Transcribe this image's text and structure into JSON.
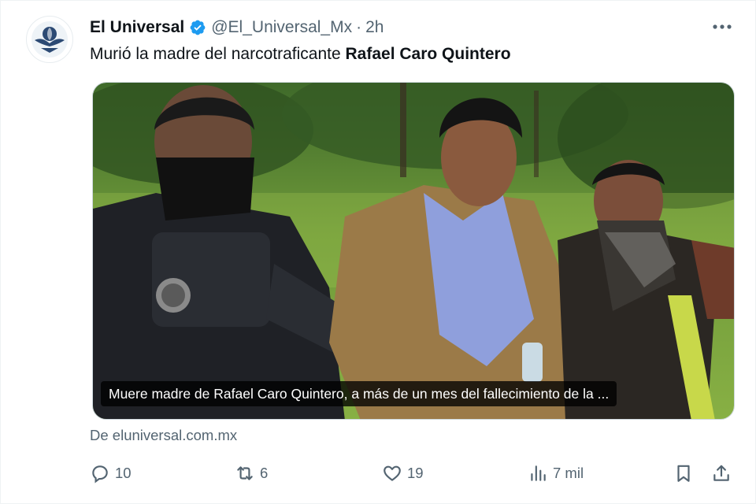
{
  "tweet": {
    "author_name": "El Universal",
    "handle": "@El_Universal_Mx",
    "separator": "·",
    "time": "2h",
    "text_prefix": "Murió la madre del narcotraficante ",
    "text_bold": "Rafael Caro Quintero",
    "media_caption": "Muere madre de Rafael Caro Quintero, a más de un mes del fallecimiento de la ...",
    "link_source": "De eluniversal.com.mx"
  },
  "actions": {
    "replies": "10",
    "reposts": "6",
    "likes": "19",
    "views": "7 mil"
  },
  "icons": {
    "avatar": "el-universal-logo",
    "verified": "verified-badge-icon",
    "more": "more-icon",
    "reply": "reply-icon",
    "repost": "repost-icon",
    "like": "heart-icon",
    "views": "views-icon",
    "bookmark": "bookmark-icon",
    "share": "share-icon"
  },
  "colors": {
    "accent_blue": "#1d9bf0",
    "secondary_text": "#536471",
    "primary_text": "#0f1419"
  }
}
